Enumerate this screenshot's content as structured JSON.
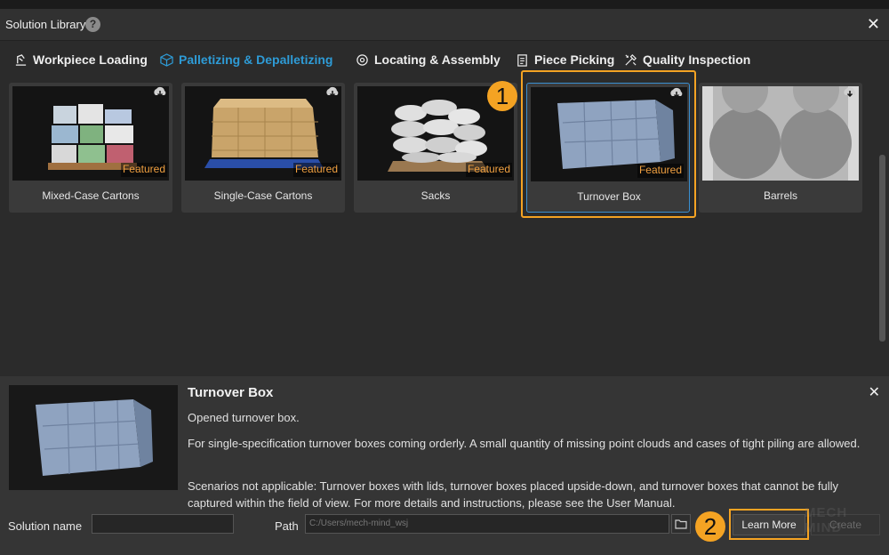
{
  "window": {
    "title": "Solution Library",
    "help_icon": "?",
    "close_icon": "✕"
  },
  "tabs": [
    {
      "label": "Workpiece Loading",
      "icon": "loading-icon",
      "active": false
    },
    {
      "label": "Palletizing & Depalletizing",
      "icon": "cube-icon",
      "active": true
    },
    {
      "label": "Locating & Assembly",
      "icon": "target-icon",
      "active": false
    },
    {
      "label": "Piece Picking",
      "icon": "clipboard-icon",
      "active": false
    },
    {
      "label": "Quality Inspection",
      "icon": "tools-icon",
      "active": false
    }
  ],
  "cards": [
    {
      "label": "Mixed-Case Cartons",
      "badge": "Featured",
      "icon": "download-icon"
    },
    {
      "label": "Single-Case Cartons",
      "badge": "Featured",
      "icon": "download-icon"
    },
    {
      "label": "Sacks",
      "badge": "Featured",
      "icon": "download-icon"
    },
    {
      "label": "Turnover Box",
      "badge": "Featured",
      "icon": "download-icon",
      "selected": true
    },
    {
      "label": "Barrels",
      "badge": "",
      "icon": "download-icon"
    }
  ],
  "annotations": {
    "marker1": "1",
    "marker2": "2"
  },
  "detail": {
    "title": "Turnover Box",
    "close_icon": "✕",
    "summary": "Opened turnover box.",
    "description": "For single-specification turnover boxes coming orderly. A small quantity of missing point clouds and cases of tight piling are allowed.",
    "scenarios": "Scenarios not applicable: Turnover boxes with lids, turnover boxes placed upside-down, and turnover boxes that cannot be fully captured within the field of view. For more details and instructions, please see the User Manual."
  },
  "footer": {
    "solution_name_label": "Solution name",
    "solution_name_value": "",
    "path_label": "Path",
    "path_value": "C:/Users/mech-mind_wsj",
    "learn_more": "Learn More",
    "create": "Create"
  },
  "watermark": "MECH MIND",
  "colors": {
    "accent": "#2e9bd6",
    "highlight": "#f4a323",
    "featured": "#f0a040",
    "background": "#2b2b2b"
  }
}
